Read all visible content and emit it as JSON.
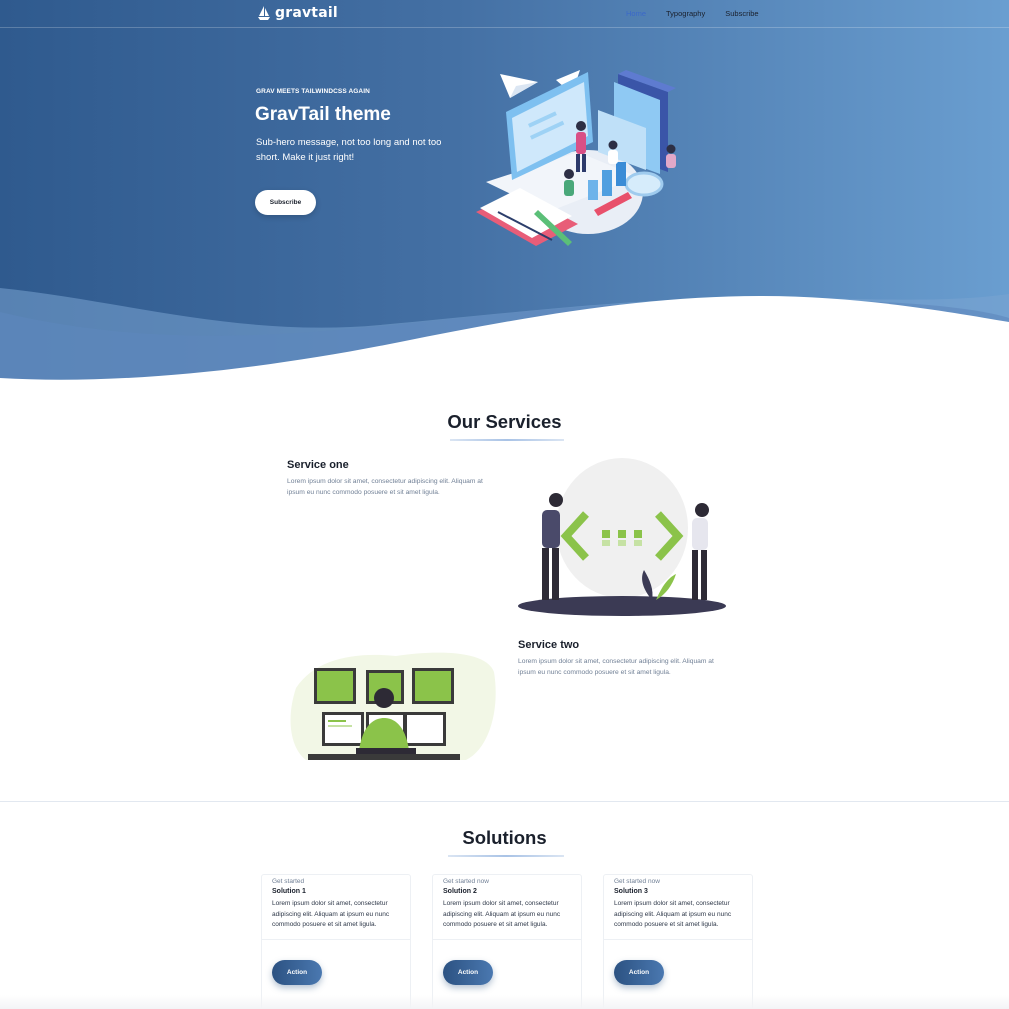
{
  "nav": {
    "logo_text": "gravtail",
    "logo_icon": "sailboat-icon",
    "links": [
      {
        "label": "Home",
        "active": true
      },
      {
        "label": "Typography",
        "active": false
      },
      {
        "label": "Subscribe",
        "active": false
      }
    ]
  },
  "hero": {
    "eyebrow": "GRAV MEETS TAILWINDCSS AGAIN",
    "title": "GravTail theme",
    "subtitle": "Sub-hero message, not too long and not too short. Make it just right!",
    "button_label": "Subscribe",
    "illustration": "isometric-workspace-illustration"
  },
  "services": {
    "title": "Our Services",
    "items": [
      {
        "title": "Service one",
        "text": "Lorem ipsum dolor sit amet, consectetur adipiscing elit. Aliquam at ipsum eu nunc commodo posuere et sit amet ligula.",
        "illustration": "developers-code-brackets-illustration"
      },
      {
        "title": "Service two",
        "text": "Lorem ipsum dolor sit amet, consectetur adipiscing elit. Aliquam at ipsum eu nunc commodo posuere et sit amet ligula.",
        "illustration": "monitors-workstation-illustration"
      }
    ]
  },
  "solutions": {
    "title": "Solutions",
    "cards": [
      {
        "kicker": "Get started",
        "title": "Solution 1",
        "text": "Lorem ipsum dolor sit amet, consectetur adipiscing elit. Aliquam at ipsum eu nunc commodo posuere et sit amet ligula.",
        "button_label": "Action"
      },
      {
        "kicker": "Get started now",
        "title": "Solution 2",
        "text": "Lorem ipsum dolor sit amet, consectetur adipiscing elit. Aliquam at ipsum eu nunc commodo posuere et sit amet ligula.",
        "button_label": "Action"
      },
      {
        "kicker": "Get started now",
        "title": "Solution 3",
        "text": "Lorem ipsum dolor sit amet, consectetur adipiscing elit. Aliquam at ipsum eu nunc commodo posuere et sit amet ligula.",
        "button_label": "Action"
      }
    ]
  },
  "colors": {
    "hero_start": "#2f5a8e",
    "hero_end": "#6a9ed0",
    "nav_active": "#3b68c9",
    "accent_green": "#8bc34a",
    "button_dark": "#2c5282"
  }
}
